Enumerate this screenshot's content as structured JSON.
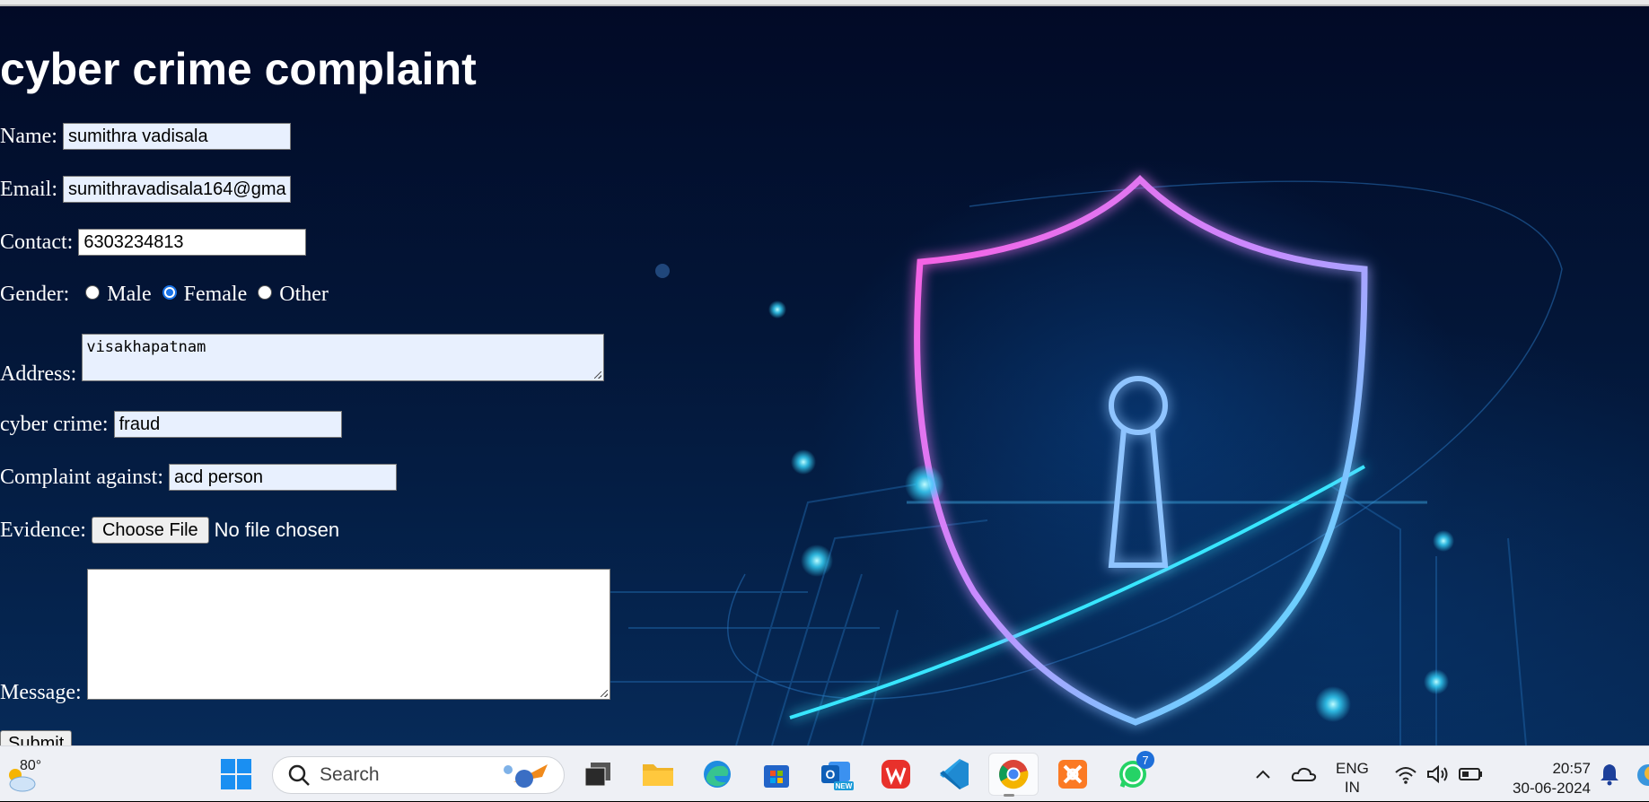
{
  "page": {
    "title": "cyber crime complaint"
  },
  "form": {
    "name": {
      "label": "Name:",
      "value": "sumithra vadisala"
    },
    "email": {
      "label": "Email:",
      "value": "sumithravadisala164@gma"
    },
    "contact": {
      "label": "Contact:",
      "value": "6303234813"
    },
    "gender": {
      "label": "Gender:",
      "options": [
        "Male",
        "Female",
        "Other"
      ],
      "selected": "Female"
    },
    "address": {
      "label": "Address:",
      "value": "visakhapatnam"
    },
    "cyber_crime": {
      "label": "cyber crime:",
      "value": "fraud"
    },
    "complaint_against": {
      "label": "Complaint against:",
      "value": "acd person"
    },
    "evidence": {
      "label": "Evidence:",
      "button_label": "Choose File",
      "status": "No file chosen"
    },
    "message": {
      "label": "Message:",
      "value": ""
    },
    "submit_label": "Submit"
  },
  "taskbar": {
    "weather": {
      "temp": "80°",
      "icon": "partly-cloudy-icon"
    },
    "start_icon": "windows-start-icon",
    "search_placeholder": "Search",
    "apps": [
      {
        "name": "task-view",
        "icon": "task-view-icon"
      },
      {
        "name": "file-explorer",
        "icon": "folder-icon"
      },
      {
        "name": "edge",
        "icon": "edge-icon"
      },
      {
        "name": "microsoft-store",
        "icon": "store-icon"
      },
      {
        "name": "outlook-new",
        "icon": "outlook-icon",
        "badge_text": "NEW"
      },
      {
        "name": "wps-office",
        "icon": "wps-icon"
      },
      {
        "name": "vscode",
        "icon": "vscode-icon"
      },
      {
        "name": "chrome",
        "icon": "chrome-icon",
        "active": true
      },
      {
        "name": "xampp",
        "icon": "xampp-icon"
      },
      {
        "name": "whatsapp",
        "icon": "whatsapp-icon",
        "badge": "7"
      }
    ],
    "tray": {
      "language_line1": "ENG",
      "language_line2": "IN",
      "time": "20:57",
      "date": "30-06-2024"
    }
  },
  "colors": {
    "background": "#031638",
    "input_autofill": "#e8f0fe",
    "taskbar": "#eef0f5",
    "accent_blue": "#1a73e8"
  }
}
